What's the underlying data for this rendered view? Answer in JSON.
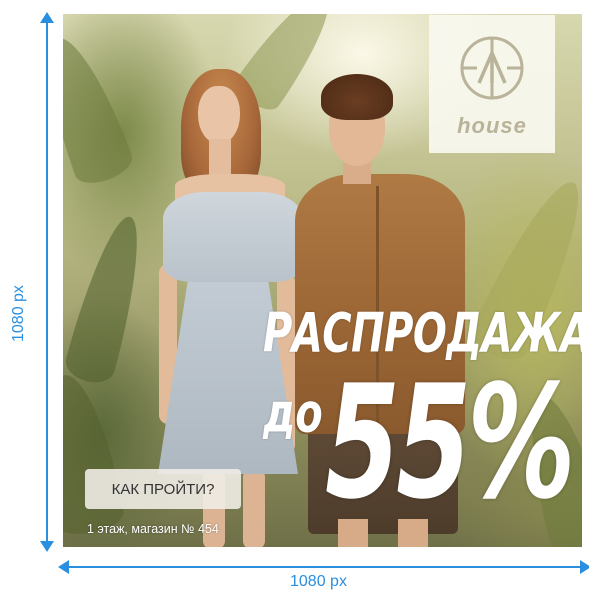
{
  "dimensions": {
    "height_label": "1080 px",
    "width_label": "1080 px",
    "accent_color": "#2b8fe0"
  },
  "logo": {
    "icon": "house-logo-icon",
    "text": "house"
  },
  "promo": {
    "headline": "РАСПРОДАЖА",
    "prefix": "до",
    "discount": "55%"
  },
  "cta": {
    "label": "КАК ПРОЙТИ?"
  },
  "store_info": "1 этаж, магазин № 454"
}
